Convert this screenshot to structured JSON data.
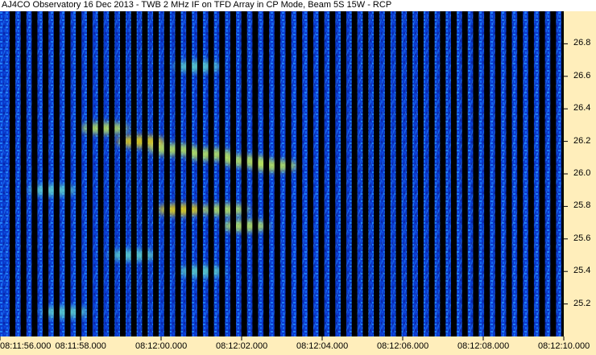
{
  "chart_data": {
    "type": "heatmap",
    "title": "AJ4CO Observatory 16 Dec 2013 - TWB 2 MHz IF on TFD Array in CP Mode, Beam 5S 15W - RCP",
    "xlabel": "",
    "ylabel": "",
    "x_tick_labels": [
      "08:11:56.000",
      "08:11:58.000",
      "08:12:00.000",
      "08:12:02.000",
      "08:12:04.000",
      "08:12:06.000",
      "08:12:08.000",
      "08:12:10.000"
    ],
    "y_tick_labels": [
      "26.8",
      "26.6",
      "26.4",
      "26.2",
      "26.0",
      "25.8",
      "25.6",
      "25.4",
      "25.2"
    ],
    "y_ticks": [
      26.8,
      26.6,
      26.4,
      26.2,
      26.0,
      25.8,
      25.6,
      25.4,
      25.2
    ],
    "xlim_seconds": [
      0,
      14
    ],
    "ylim": [
      25.0,
      27.0
    ],
    "grid": false,
    "colormap": [
      "#000033",
      "#0014b4",
      "#0050f0",
      "#14a0ff",
      "#64dcc8",
      "#c8f050",
      "#ffe000"
    ],
    "bursts": [
      {
        "t": 2.6,
        "f": 26.28,
        "intensity": 0.8
      },
      {
        "t": 3.5,
        "f": 26.2,
        "intensity": 0.9
      },
      {
        "t": 4.3,
        "f": 26.15,
        "intensity": 0.75
      },
      {
        "t": 5.2,
        "f": 26.12,
        "intensity": 0.7
      },
      {
        "t": 6.1,
        "f": 26.08,
        "intensity": 0.65
      },
      {
        "t": 6.8,
        "f": 26.05,
        "intensity": 0.7
      },
      {
        "t": 4.5,
        "f": 25.78,
        "intensity": 0.9
      },
      {
        "t": 5.6,
        "f": 25.78,
        "intensity": 0.75
      },
      {
        "t": 6.1,
        "f": 25.68,
        "intensity": 0.85
      },
      {
        "t": 4.9,
        "f": 26.66,
        "intensity": 0.55
      },
      {
        "t": 3.3,
        "f": 25.5,
        "intensity": 0.55
      },
      {
        "t": 1.3,
        "f": 25.9,
        "intensity": 0.5
      },
      {
        "t": 1.6,
        "f": 25.15,
        "intensity": 0.5
      },
      {
        "t": 5.0,
        "f": 25.4,
        "intensity": 0.5
      }
    ]
  },
  "colors": {
    "background": "#ffffff",
    "axis_band": "#ffeebb",
    "gap": "#000000"
  }
}
